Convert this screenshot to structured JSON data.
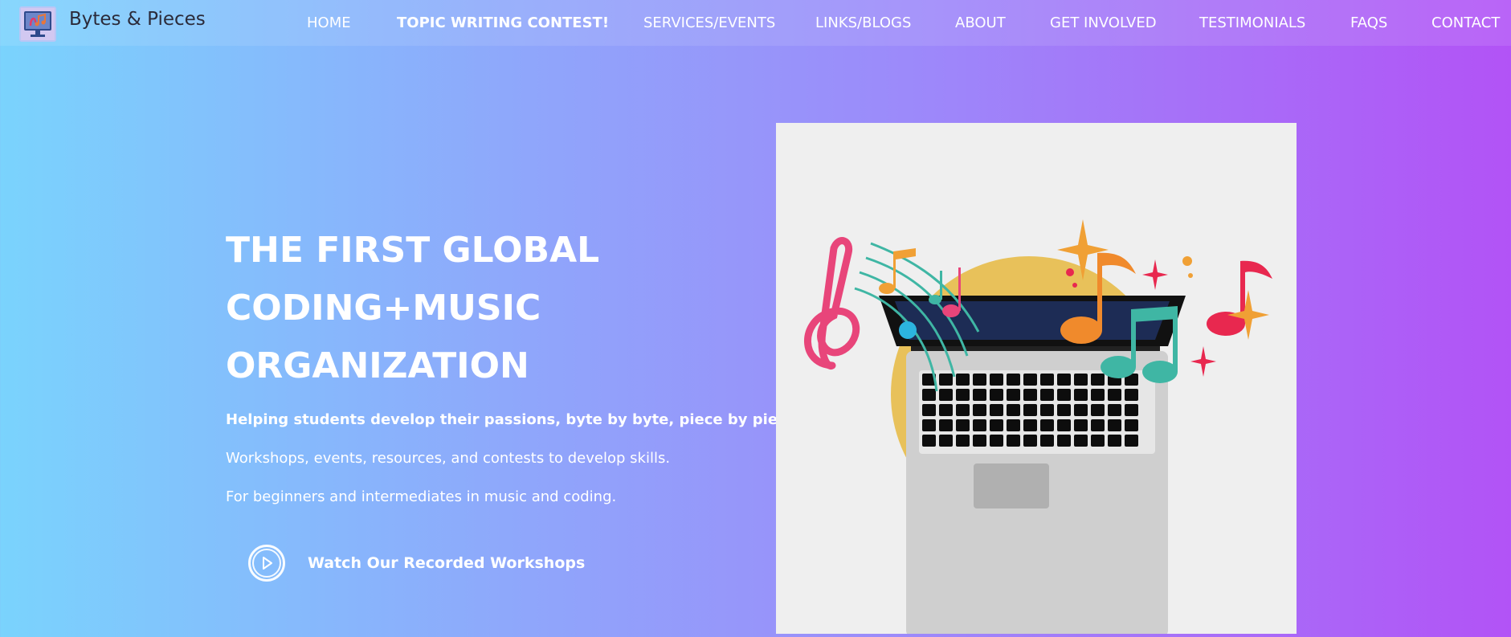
{
  "header": {
    "brand": "Bytes & Pieces",
    "nav": [
      {
        "label": "HOME"
      },
      {
        "label": "TOPIC WRITING CONTEST!"
      },
      {
        "label": "SERVICES/EVENTS"
      },
      {
        "label": "LINKS/BLOGS"
      },
      {
        "label": "ABOUT"
      },
      {
        "label": "GET INVOLVED"
      },
      {
        "label": "TESTIMONIALS"
      },
      {
        "label": "FAQS"
      },
      {
        "label": "CONTACT"
      }
    ]
  },
  "hero": {
    "title_lines": [
      "THE FIRST GLOBAL",
      "CODING+MUSIC",
      "ORGANIZATION"
    ],
    "tagline": "Helping students develop their passions, byte by byte, piece by piece.",
    "line1": "Workshops, events, resources, and contests to develop skills.",
    "line2": "For beginners and intermediates in music and coding.",
    "cta": "Watch Our Recorded Workshops"
  },
  "icons": {
    "logo": "monitor-music-logo-icon",
    "play": "play-icon"
  },
  "colors": {
    "gradient_start": "#7ad3fd",
    "gradient_end": "#b253f6",
    "illustration_bg": "#efefef",
    "sun": "#e8c15a"
  }
}
